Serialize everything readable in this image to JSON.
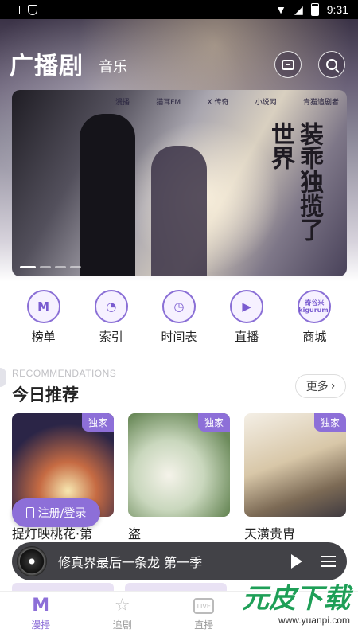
{
  "status_bar": {
    "time": "9:31"
  },
  "header": {
    "tab_active": "广播剧",
    "tab_inactive": "音乐",
    "mail_icon": "mail-icon",
    "search_icon": "search-icon"
  },
  "banner": {
    "logos": [
      "漫播",
      "猫耳FM",
      "X 传奇",
      "小说网",
      "青猫追剧者"
    ],
    "calligraphy": "装乖独揽了世界",
    "dots": 4,
    "active_dot": 0
  },
  "quick_nav": [
    {
      "label": "榜单",
      "icon": "ranking-icon",
      "glyph": "M"
    },
    {
      "label": "索引",
      "icon": "index-icon",
      "glyph": "◔"
    },
    {
      "label": "时间表",
      "icon": "schedule-icon",
      "glyph": "◷"
    },
    {
      "label": "直播",
      "icon": "live-icon",
      "glyph": "▶"
    },
    {
      "label": "商城",
      "icon": "shop-brand-icon",
      "brand_top": "奇谷米",
      "brand_bottom": "kigurumi"
    }
  ],
  "recommendations": {
    "eyebrow": "RECOMMENDATIONS",
    "title": "今日推荐",
    "more_label": "更多",
    "cards": [
      {
        "title": "提灯映桃花·第",
        "badge": "独家"
      },
      {
        "title": "盗",
        "badge": "独家"
      },
      {
        "title": "天潢贵胄",
        "badge": "独家"
      }
    ]
  },
  "register_button": {
    "label": "注册/登录"
  },
  "player": {
    "title": "修真界最后一条龙 第一季"
  },
  "tabbar": [
    {
      "label": "漫播",
      "active": true
    },
    {
      "label": "追剧",
      "active": false
    },
    {
      "label": "直播",
      "active": false
    }
  ],
  "watermark": {
    "text": "元皮下载",
    "url": "www.yuanpi.com"
  },
  "colors": {
    "accent": "#8d6fd8",
    "watermark": "#1e9f57"
  }
}
